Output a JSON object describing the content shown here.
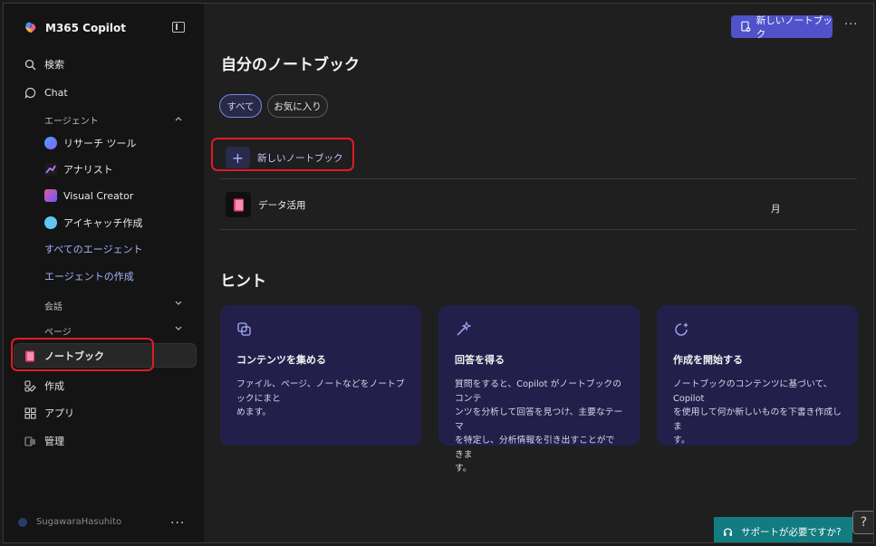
{
  "app": {
    "title": "M365 Copilot"
  },
  "sidebar": {
    "search": "検索",
    "chat": "Chat",
    "agents_section": "エージェント",
    "agents": [
      {
        "label": "リサーチ ツール",
        "color": "#5b6cff"
      },
      {
        "label": "アナリスト",
        "color": "#8a5cff"
      },
      {
        "label": "Visual Creator",
        "color": "#d24c9a"
      },
      {
        "label": "アイキャッチ作成",
        "color": "#5fc8f2"
      }
    ],
    "all_agents": "すべてのエージェント",
    "create_agent": "エージェントの作成",
    "conversations_section": "会話",
    "pages_section": "ページ",
    "notebook": "ノートブック",
    "create": "作成",
    "apps": "アプリ",
    "admin": "管理",
    "user_name": "SugawaraHasuhito"
  },
  "header": {
    "new_notebook_button": "新しいノートブック"
  },
  "main": {
    "title": "自分のノートブック",
    "filters": [
      "すべて",
      "お気に入り"
    ],
    "new_notebook_row": "新しいノートブック",
    "notebooks": [
      {
        "name": "データ活用",
        "date": "月"
      }
    ],
    "hints_title": "ヒント",
    "hints": [
      {
        "title": "コンテンツを集める",
        "desc_lines": [
          "ファイル、ページ、ノートなどをノートブックにまと",
          "めます。"
        ]
      },
      {
        "title": "回答を得る",
        "desc_lines": [
          "質問をすると、Copilot がノートブックのコンテ",
          "ンツを分析して回答を見つけ、主要なテーマ",
          "を特定し、分析情報を引き出すことができま",
          "す。"
        ]
      },
      {
        "title": "作成を開始する",
        "desc_lines": [
          "ノートブックのコンテンツに基づいて、Copilot",
          "を使用して何か新しいものを下書き作成しま",
          "す。"
        ]
      }
    ]
  },
  "support": {
    "label": "サポートが必要ですか?",
    "help": "?"
  },
  "colors": {
    "accent": "#4f52c9",
    "highlight": "#e01b24",
    "card": "#22204a",
    "support": "#127c80"
  }
}
